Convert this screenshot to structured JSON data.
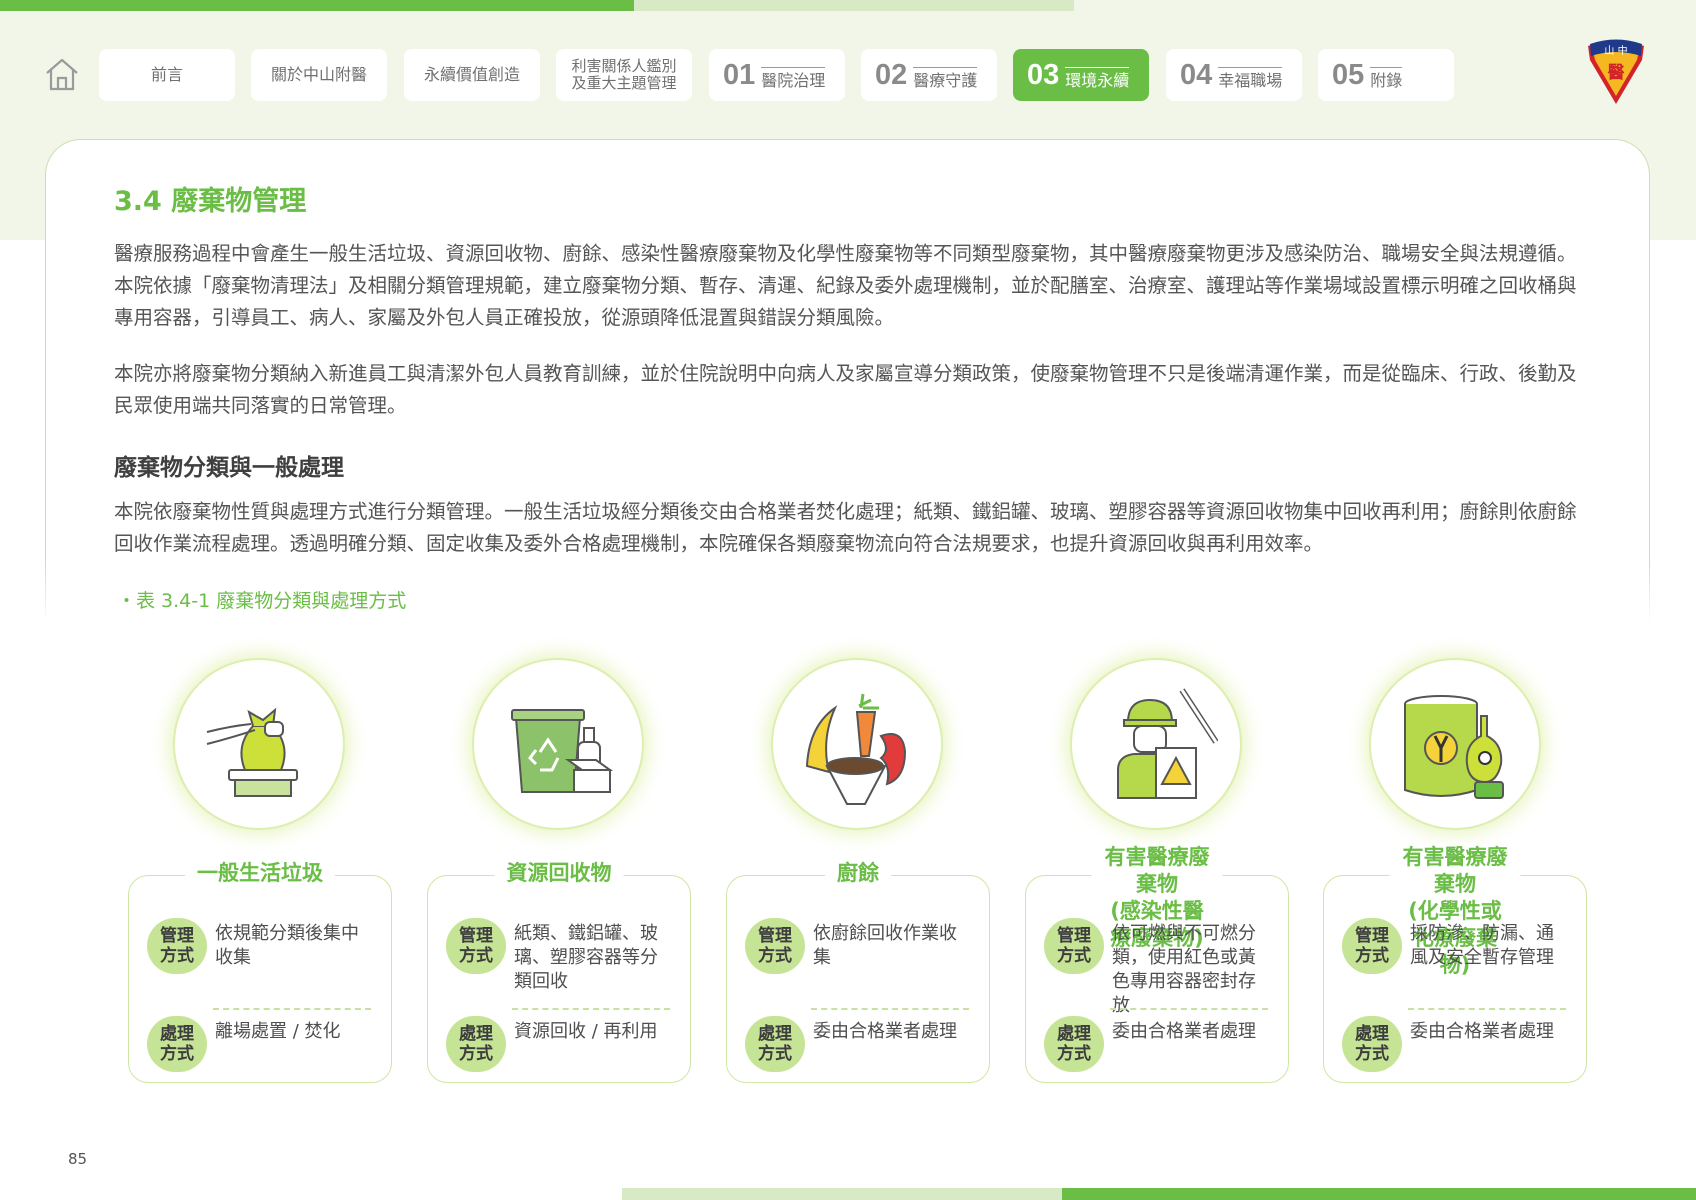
{
  "nav": {
    "tabs": [
      {
        "label": "前言"
      },
      {
        "label": "關於中山附醫"
      },
      {
        "label": "永續價值創造"
      },
      {
        "label": "利害關係人鑑別\n及重大主題管理"
      },
      {
        "num": "01",
        "label": "醫院治理"
      },
      {
        "num": "02",
        "label": "醫療守護"
      },
      {
        "num": "03",
        "label": "環境永續"
      },
      {
        "num": "04",
        "label": "幸福職場"
      },
      {
        "num": "05",
        "label": "附錄"
      }
    ]
  },
  "logo": {
    "text": "中山醫"
  },
  "section": {
    "title": "3.4 廢棄物管理",
    "para1": "醫療服務過程中會產生一般生活垃圾、資源回收物、廚餘、感染性醫療廢棄物及化學性廢棄物等不同類型廢棄物，其中醫療廢棄物更涉及感染防治、職場安全與法規遵循。本院依據「廢棄物清理法」及相關分類管理規範，建立廢棄物分類、暫存、清運、紀錄及委外處理機制，並於配膳室、治療室、護理站等作業場域設置標示明確之回收桶與專用容器，引導員工、病人、家屬及外包人員正確投放，從源頭降低混置與錯誤分類風險。",
    "para2": "本院亦將廢棄物分類納入新進員工與清潔外包人員教育訓練，並於住院說明中向病人及家屬宣導分類政策，使廢棄物管理不只是後端清運作業，而是從臨床、行政、後勤及民眾使用端共同落實的日常管理。",
    "subtitle": "廢棄物分類與一般處理",
    "para3": "本院依廢棄物性質與處理方式進行分類管理。一般生活垃圾經分類後交由合格業者焚化處理；紙類、鐵鋁罐、玻璃、塑膠容器等資源回收物集中回收再利用；廚餘則依廚餘回收作業流程處理。透過明確分類、固定收集及委外合格處理機制，本院確保各類廢棄物流向符合法規要求，也提升資源回收與再利用效率。",
    "caption": "・表 3.4-1 廢棄物分類與處理方式"
  },
  "cards": [
    {
      "title": "一般生活垃圾",
      "mgmt_label": "管理方式",
      "mgmt": "依規範分類後集中收集",
      "proc_label": "處理方式",
      "proc": "離場處置 / 焚化"
    },
    {
      "title": "資源回收物",
      "mgmt_label": "管理方式",
      "mgmt": "紙類、鐵鋁罐、玻璃、塑膠容器等分類回收",
      "proc_label": "處理方式",
      "proc": "資源回收 / 再利用"
    },
    {
      "title": "廚餘",
      "mgmt_label": "管理方式",
      "mgmt": "依廚餘回收作業收集",
      "proc_label": "處理方式",
      "proc": "委由合格業者處理"
    },
    {
      "title": "有害醫療廢棄物\n(感染性醫療廢棄物)",
      "mgmt_label": "管理方式",
      "mgmt": "依可燃與不可燃分類，使用紅色或黃色專用容器密封存放",
      "proc_label": "處理方式",
      "proc": "委由合格業者處理"
    },
    {
      "title": "有害醫療廢棄物\n(化學性或化療廢棄物)",
      "mgmt_label": "管理方式",
      "mgmt": "採防滲、防漏、通風及安全暫存管理",
      "proc_label": "處理方式",
      "proc": "委由合格業者處理"
    }
  ],
  "icons": [
    "garbage-bag-icon",
    "recycling-bin-icon",
    "food-waste-icon",
    "medical-waste-worker-icon",
    "chemical-waste-icon"
  ],
  "page_number": "85",
  "colors": {
    "accent": "#6abd45",
    "accent_light": "#d7e9c5",
    "pill": "#c6e495",
    "band": "#f1f6e8"
  }
}
